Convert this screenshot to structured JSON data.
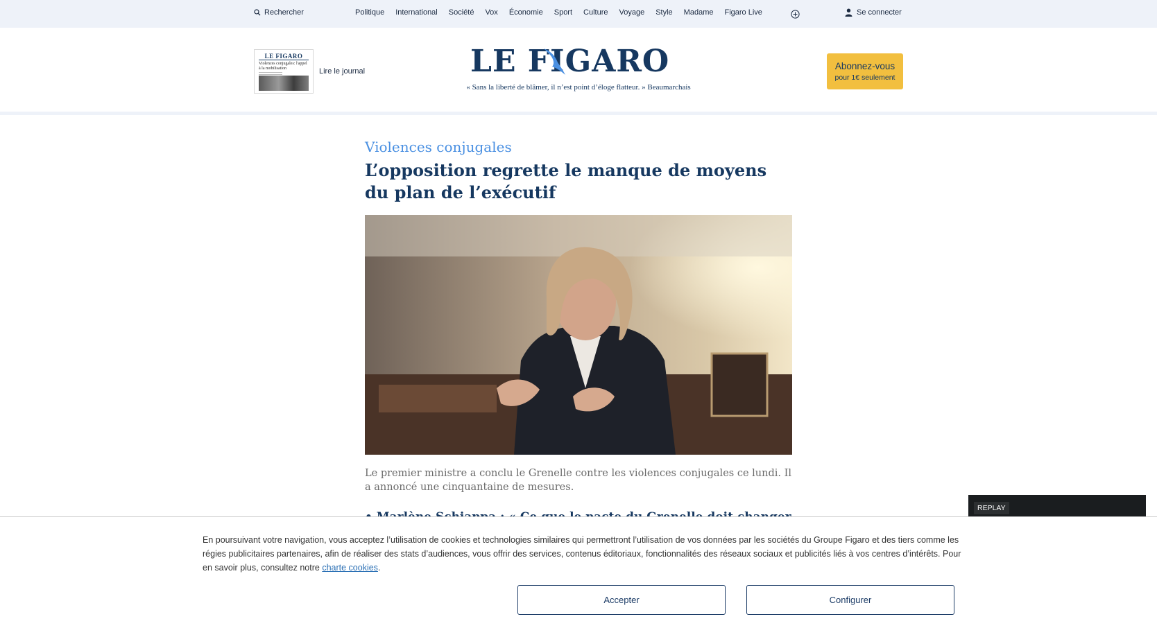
{
  "topbar": {
    "search_label": "Rechercher",
    "nav": [
      "Politique",
      "International",
      "Société",
      "Vox",
      "Économie",
      "Sport",
      "Culture",
      "Voyage",
      "Style",
      "Madame",
      "Figaro Live"
    ],
    "more_icon": "plus-circle-icon",
    "login_label": "Se connecter"
  },
  "masthead": {
    "journal_label": "Lire le journal",
    "journal_thumb_logo": "LE FIGARO",
    "journal_thumb_headline": "Violences conjugales: l'appel à la mobilisation",
    "logo_text": "LE FIGARO",
    "tagline": "« Sans la liberté de blâmer, il n’est point d’éloge flatteur. » Beaumarchais",
    "subscribe_title": "Abonnez-vous",
    "subscribe_sub": "pour 1€ seulement",
    "subscribe_color": "#f2bf3f",
    "brand_color": "#163860"
  },
  "article": {
    "kicker": "Violences conjugales",
    "headline": "L’opposition regrette le manque de moyens du plan de l’exécutif",
    "caption": "Le premier ministre a conclu le Grenelle contre les violences conjugales ce lundi. Il a annoncé une cinquantaine de mesures.",
    "related_partial": "• Marlène Schiappa : « Ce que le pacte du Grenelle doit changer »"
  },
  "replay": {
    "badge": "REPLAY"
  },
  "cookie": {
    "text": "En poursuivant votre navigation, vous acceptez l’utilisation de cookies et technologies similaires qui permettront l’utilisation de vos données par les sociétés du Groupe Figaro et des tiers comme les régies publicitaires partenaires, afin de réaliser des stats d’audiences, vous offrir des services, contenus éditoriaux, fonctionnalités des réseaux sociaux et publicités liés à vos centres d’intérêts. Pour en savoir plus, consultez notre ",
    "link": "charte cookies",
    "end": ".",
    "accept": "Accepter",
    "configure": "Configurer"
  }
}
